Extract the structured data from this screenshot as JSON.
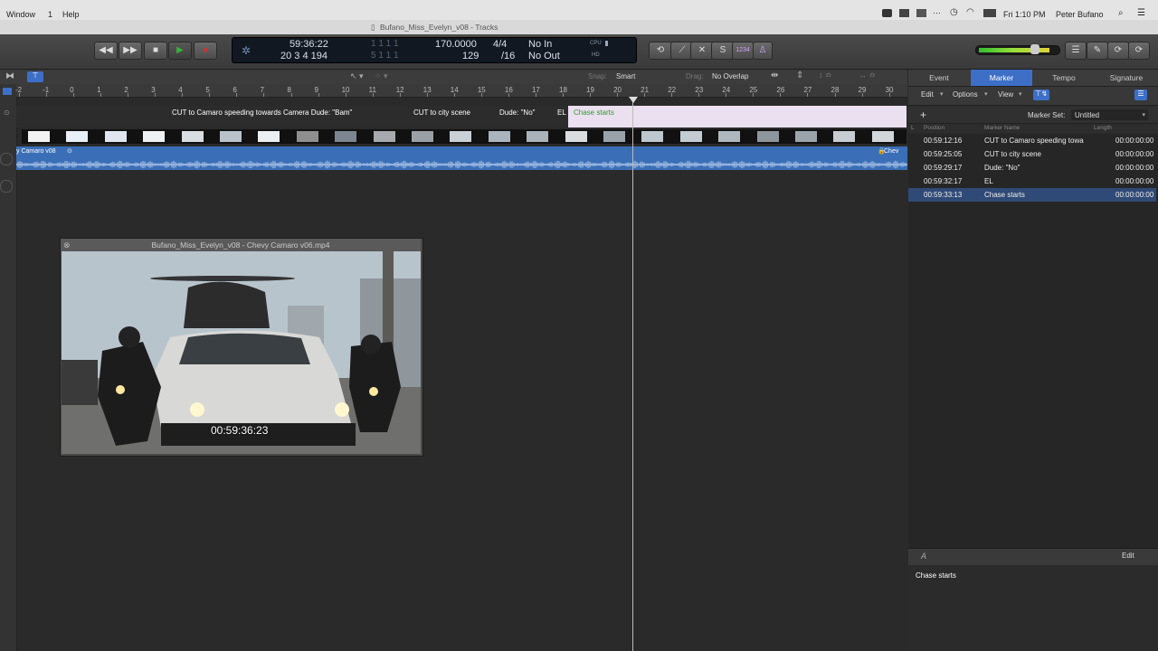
{
  "menubar": {
    "items": [
      "Window",
      "1",
      "Help"
    ],
    "clock": "Fri 1:10 PM",
    "user": "Peter Bufano"
  },
  "window": {
    "title": "Bufano_Miss_Evelyn_v08 - Tracks"
  },
  "lcd": {
    "time": "59:36:22",
    "time_dim": "1  1  1      1",
    "bars": "20  3  4  194",
    "bars_dim": "5  1  1      1",
    "tempo": "170.0000",
    "tempo2": "129",
    "sig": "4/4",
    "div": "/16",
    "in": "No In",
    "out": "No Out",
    "cpu": "CPU",
    "hd": "HD"
  },
  "toolbar_right": {
    "counter": "1234"
  },
  "tracks": {
    "snap_label": "Snap:",
    "snap_value": "Smart",
    "drag_label": "Drag:",
    "drag_value": "No Overlap",
    "ruler": [
      "-2",
      "-1",
      "0",
      "1",
      "2",
      "3",
      "4",
      "5",
      "6",
      "7",
      "8",
      "9",
      "10",
      "11",
      "12",
      "13",
      "14",
      "15",
      "16",
      "17",
      "18",
      "19",
      "20",
      "21",
      "22",
      "23",
      "24",
      "25",
      "26",
      "27",
      "28",
      "29",
      "30"
    ],
    "markers": [
      "CUT to Camaro speeding towards Camera Dude: \"Bam\"",
      "CUT to city scene",
      "Dude: \"No\"",
      "EL",
      "Chase starts"
    ],
    "audio_region": "y Camaro v08",
    "audio_region_right": "Chev"
  },
  "video": {
    "title": "Bufano_Miss_Evelyn_v08 - Chevy Camaro v06.mp4",
    "timecode": "00:59:36:23"
  },
  "panel": {
    "tabs": [
      "Event",
      "Marker",
      "Tempo",
      "Signature"
    ],
    "active_tab": "Marker",
    "edit": "Edit",
    "options": "Options",
    "view": "View",
    "marker_set_label": "Marker Set:",
    "marker_set_value": "Untitled",
    "col_position": "Position",
    "col_name": "Marker Name",
    "col_length": "Length",
    "rows": [
      {
        "position": "00:59:12:16",
        "name": "CUT to Camaro speeding towa",
        "length": "00:00:00:00"
      },
      {
        "position": "00:59:25:05",
        "name": "CUT to city scene",
        "length": "00:00:00:00"
      },
      {
        "position": "00:59:29:17",
        "name": "Dude: \"No\"",
        "length": "00:00:00:00"
      },
      {
        "position": "00:59:32:17",
        "name": "EL",
        "length": "00:00:00:00"
      },
      {
        "position": "00:59:33:13",
        "name": "Chase starts",
        "length": "00:00:00:00"
      }
    ],
    "selected_row": 4,
    "notes_edit": "Edit",
    "notes_text": "Chase starts"
  },
  "colors": {
    "accent": "#3d6fc7",
    "audio": "#3a6fb7",
    "play": "#3ab03a",
    "record": "#d23030",
    "chase_region": "#ebe0ef",
    "chase_text": "#2a9a2a"
  }
}
